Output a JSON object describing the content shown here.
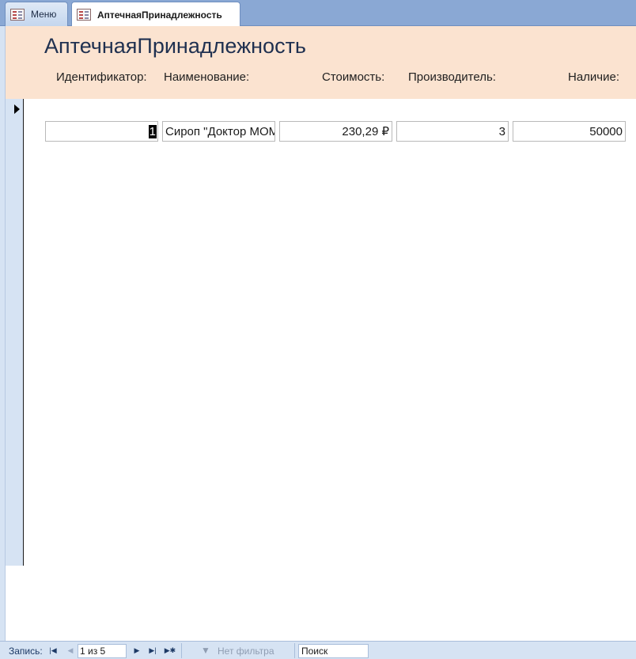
{
  "tabs": [
    {
      "label": "Меню",
      "icon": "form-icon"
    },
    {
      "label": "АптечнаяПринадлежность",
      "icon": "form-icon",
      "active": true
    }
  ],
  "form": {
    "title": "АптечнаяПринадлежность",
    "columns": [
      "Идентификатор:",
      "Наименование:",
      "Стоимость:",
      "Производитель:",
      "Наличие:"
    ],
    "record": {
      "id": "1",
      "name": "Сироп \"Доктор МОМ\"",
      "cost": "230,29 ₽",
      "maker": "3",
      "availability": "50000"
    }
  },
  "navigation": {
    "label": "Запись:",
    "position": "1 из 5",
    "filter_label": "Нет фильтра",
    "search_placeholder": "Поиск"
  },
  "colors": {
    "header_bg": "#fbe3d0",
    "tabbar_bg": "#8aa8d4",
    "title_color": "#1f3050"
  }
}
